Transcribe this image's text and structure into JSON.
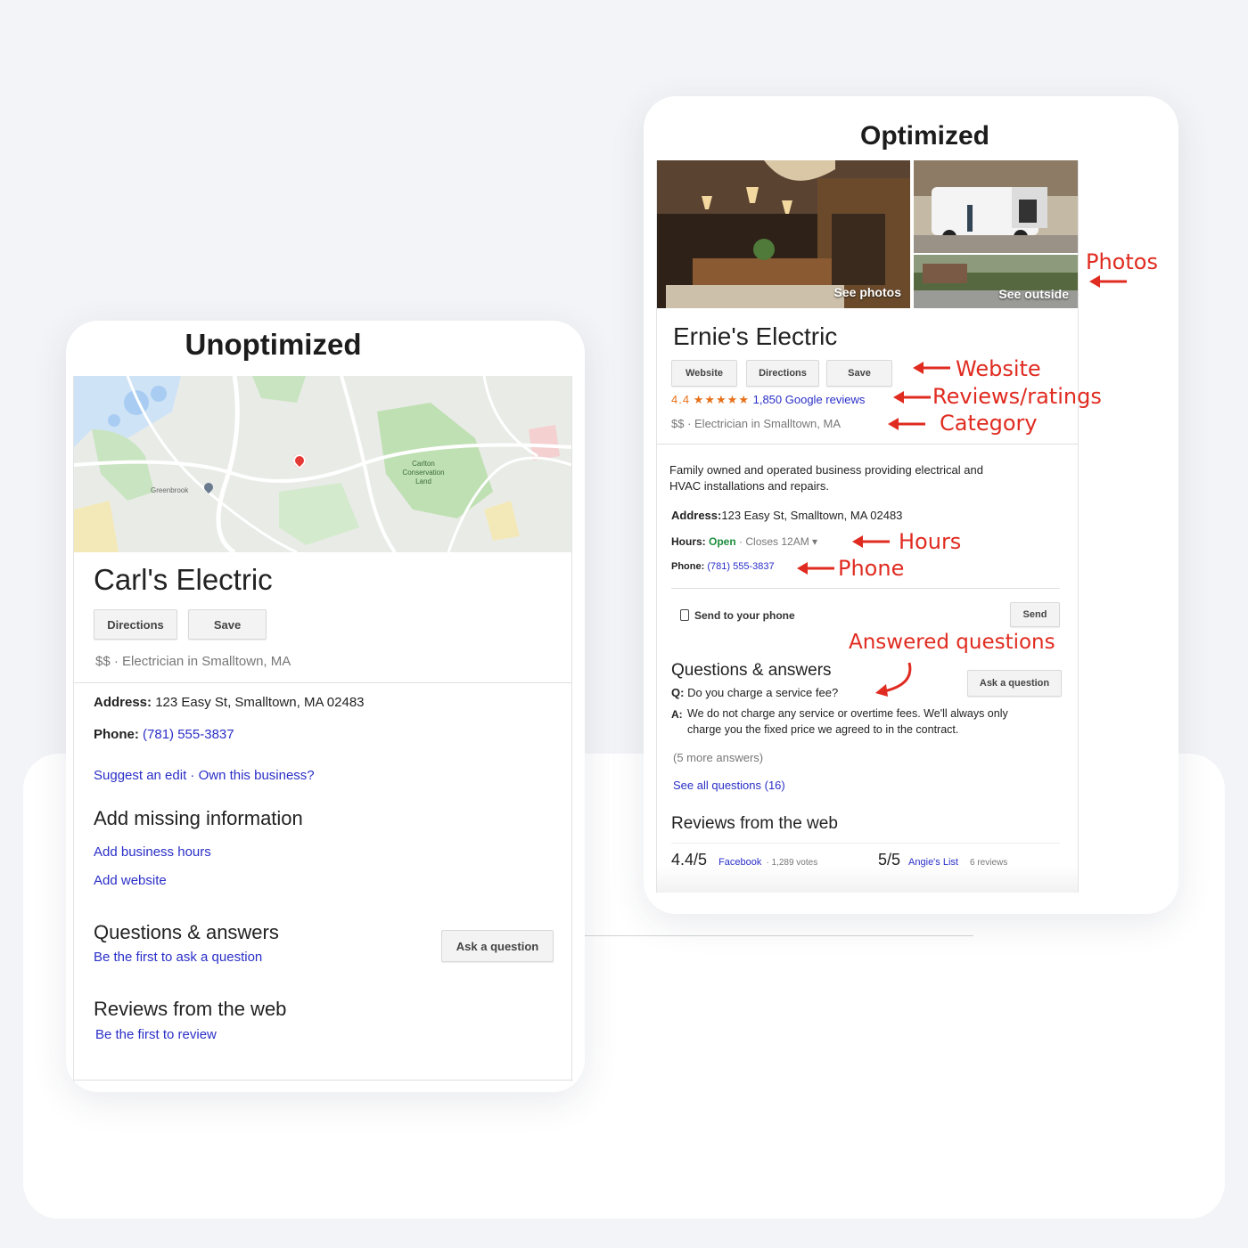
{
  "left": {
    "title": "Unoptimized",
    "business_name": "Carl's Electric",
    "directions_label": "Directions",
    "save_label": "Save",
    "category": "$$ · Electrician in Smalltown, MA",
    "address_label": "Address:",
    "address_value": "123 Easy St, Smalltown, MA 02483",
    "phone_label": "Phone:",
    "phone_value": "(781) 555-3837",
    "suggest_edit": "Suggest an edit · Own this business?",
    "missing_title": "Add missing information",
    "add_hours": "Add business hours",
    "add_website": "Add website",
    "qa_title": "Questions & answers",
    "qa_first": "Be the first to ask a question",
    "ask_question": "Ask a question",
    "reviews_title": "Reviews from the web",
    "reviews_first": "Be the first to review",
    "map_labels": {
      "greenbrook": "Greenbrook",
      "park": "Carlton Conservation Land"
    }
  },
  "right": {
    "title": "Optimized",
    "see_photos": "See photos",
    "see_outside": "See outside",
    "business_name": "Ernie's Electric",
    "website_label": "Website",
    "directions_label": "Directions",
    "save_label": "Save",
    "rating": "4.4",
    "stars": "★★★★★",
    "reviews_link": "1,850 Google reviews",
    "category": "$$ · Electrician in Smalltown, MA",
    "description_1": "Family owned and operated business providing electrical and",
    "description_2": "HVAC installations and repairs.",
    "address_label": "Address:",
    "address_value": "123 Easy St, Smalltown, MA 02483",
    "hours_label": "Hours:",
    "hours_open": "Open",
    "hours_closes": "· Closes 12AM ▾",
    "phone_label": "Phone:",
    "phone_value": "(781) 555-3837",
    "send_to_phone": "Send to your phone",
    "send_label": "Send",
    "qa_title": "Questions & answers",
    "ask_question": "Ask a question",
    "q_label": "Q:",
    "question": "Do you charge a service fee?",
    "a_label": "A:",
    "answer_1": "We do not charge any service or overtime fees. We'll always only",
    "answer_2": "charge you the fixed price we agreed to in the contract.",
    "more_answers": "(5 more answers)",
    "see_all": "See all questions (16)",
    "reviews_title": "Reviews from the web",
    "review1_score": "4.4/5",
    "review1_source": "Facebook",
    "review1_votes": "· 1,289 votes",
    "review2_score": "5/5",
    "review2_source": "Angie's List",
    "review2_votes": "6 reviews"
  },
  "annotations": {
    "photos": "Photos",
    "website": "Website",
    "reviews": "Reviews/ratings",
    "category": "Category",
    "hours": "Hours",
    "phone": "Phone",
    "answered": "Answered questions"
  },
  "colors": {
    "annotation_red": "#e02b20",
    "link_blue": "#2a2fc7",
    "open_green": "#1e8e3e",
    "star_orange": "#e7711b"
  }
}
